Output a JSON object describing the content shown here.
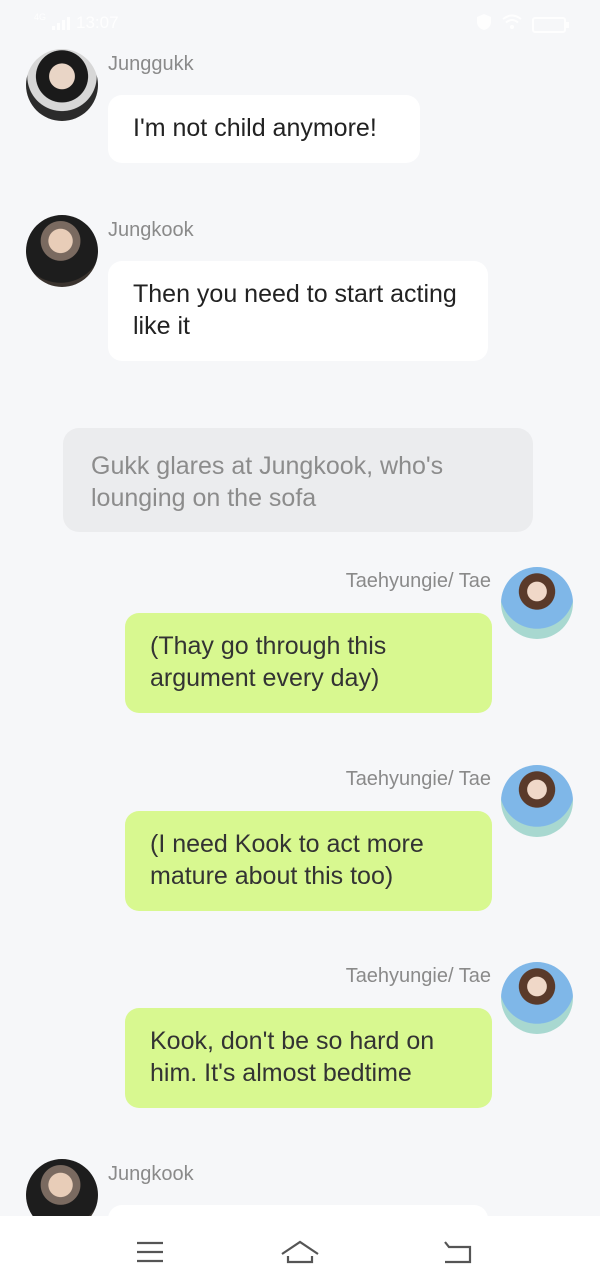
{
  "status_bar": {
    "time": "13:07",
    "network": "4G"
  },
  "messages": [
    {
      "type": "incoming",
      "sender": "Junggukk",
      "avatar": "junggukk-avatar",
      "text": "I'm not child anymore!"
    },
    {
      "type": "incoming",
      "sender": "Jungkook",
      "avatar": "jungkook-avatar",
      "text": "Then you need to start acting like it"
    },
    {
      "type": "narration",
      "text": "Gukk glares at Jungkook, who's lounging on the sofa"
    },
    {
      "type": "outgoing",
      "sender": "Taehyungie/ Tae",
      "avatar": "tae-avatar",
      "text": "(Thay go through this argument every day)"
    },
    {
      "type": "outgoing",
      "sender": "Taehyungie/ Tae",
      "avatar": "tae-avatar",
      "text": "(I need Kook to act more mature about this too)"
    },
    {
      "type": "outgoing",
      "sender": "Taehyungie/ Tae",
      "avatar": "tae-avatar",
      "text": "Kook, don't be so hard on him. It's almost bedtime"
    },
    {
      "type": "incoming",
      "sender": "Jungkook",
      "avatar": "jungkook-avatar",
      "text": ""
    }
  ],
  "nav_bar": {
    "menu_icon": "menu-icon",
    "home_icon": "home-icon",
    "back_icon": "back-icon"
  },
  "colors": {
    "background": "#f6f7f9",
    "incoming_bubble": "#ffffff",
    "outgoing_bubble": "#d8f890",
    "narration_bubble": "#ebecee"
  }
}
